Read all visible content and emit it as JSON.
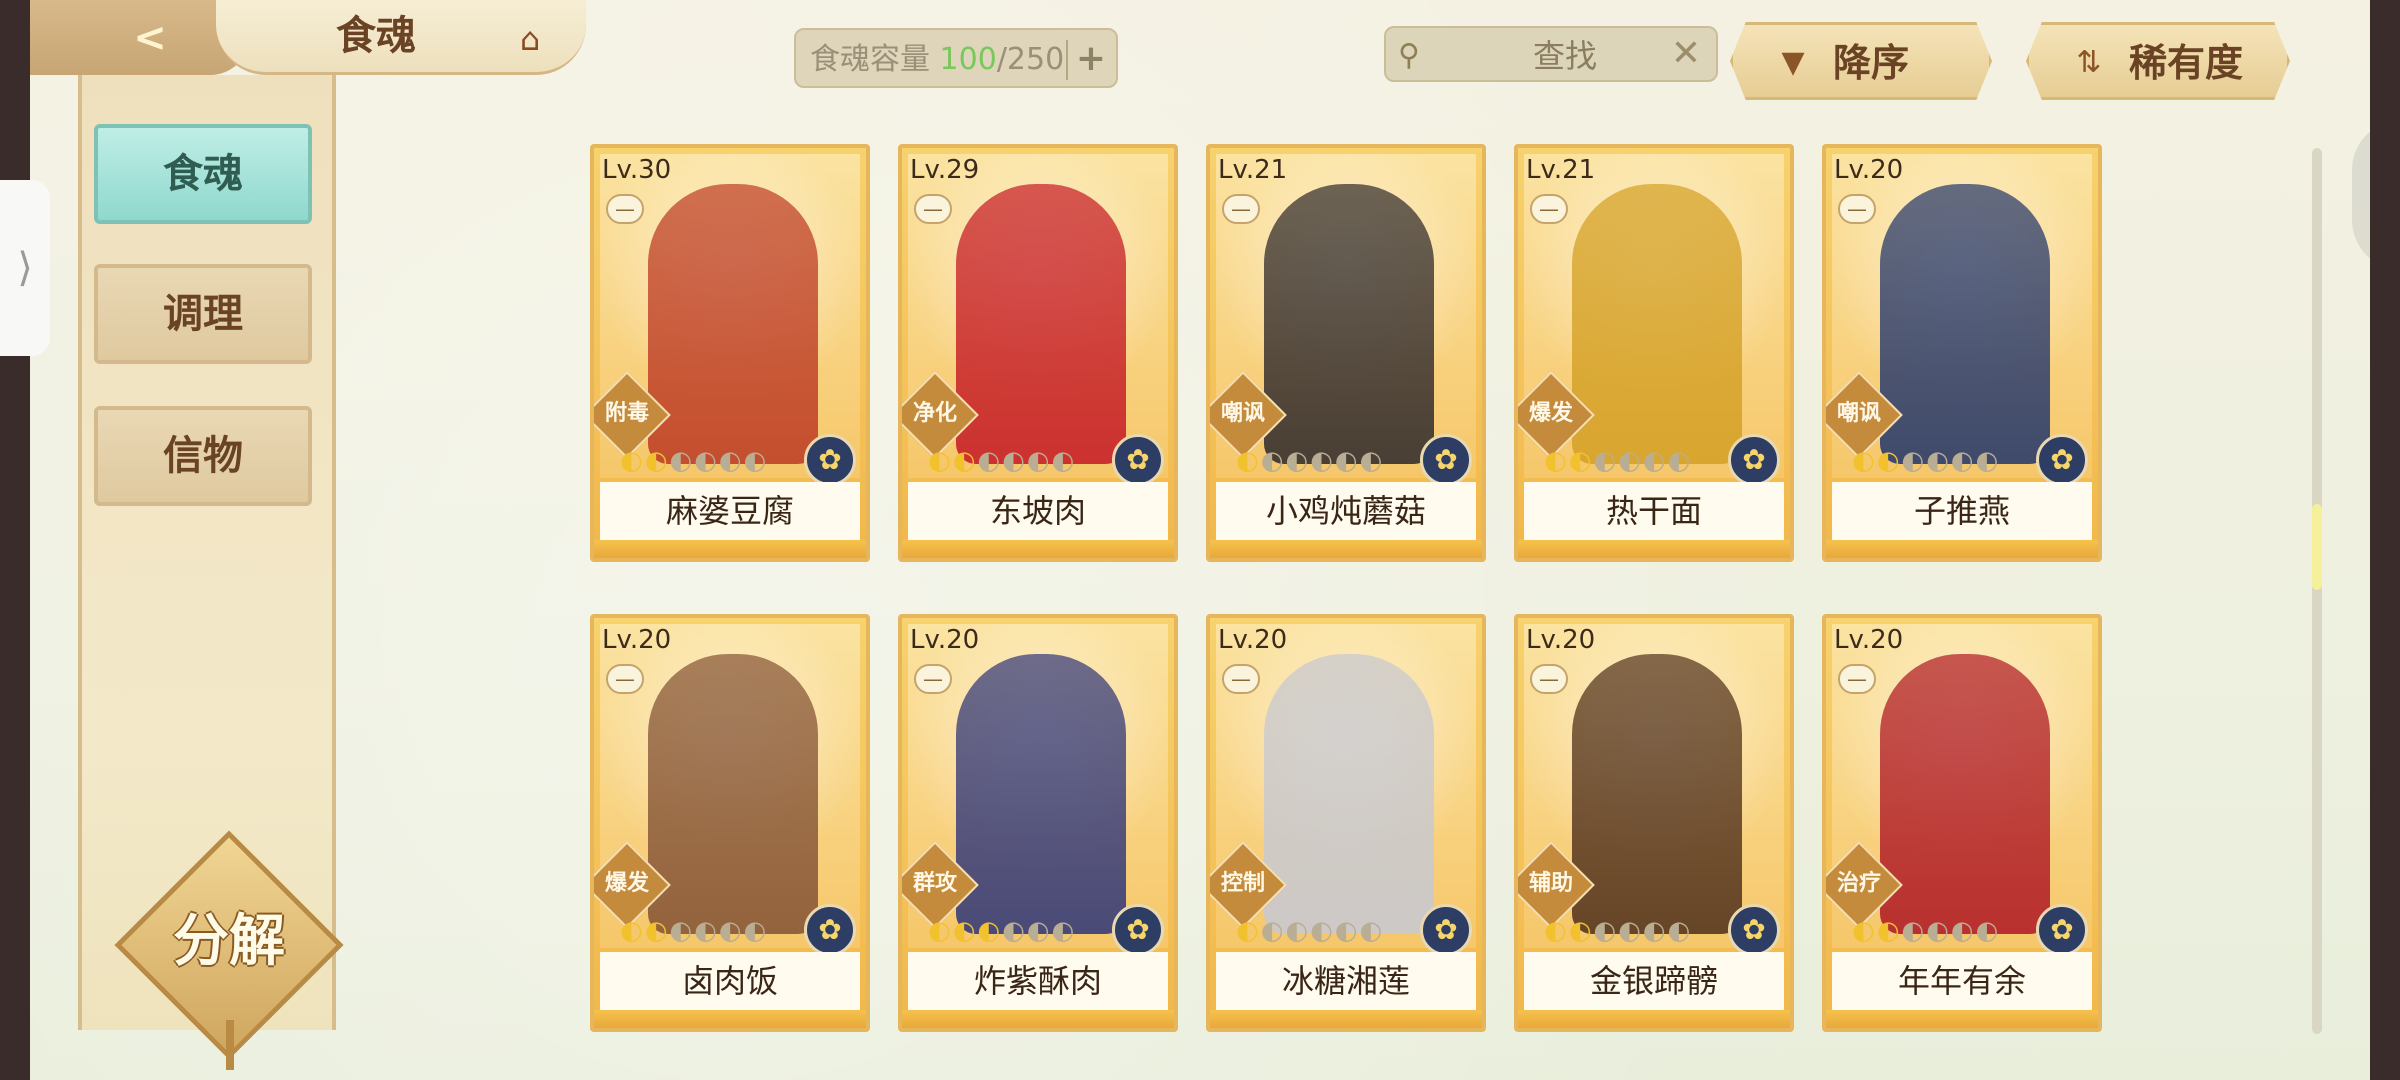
{
  "header": {
    "back_icon": "back-arrow-icon",
    "title": "食魂",
    "home_icon": "pavilion-icon",
    "capacity": {
      "label": "食魂容量 ",
      "current": "100",
      "separator": "/",
      "max": "250",
      "plus": "+"
    },
    "search": {
      "icon": "search-icon",
      "text": "查找",
      "clear": "✕"
    },
    "sort_desc": {
      "icon": "down-triangle-icon",
      "label": "降序"
    },
    "sort_rarity": {
      "icon": "sort-toggle-icon",
      "label": "稀有度"
    }
  },
  "sidebar": {
    "handle": "⟩",
    "items": [
      {
        "label": "食魂",
        "active": true
      },
      {
        "label": "调理",
        "active": false
      },
      {
        "label": "信物",
        "active": false
      }
    ],
    "decompose_label": "分解"
  },
  "cards": [
    {
      "level": "Lv.30",
      "role": "附毒",
      "name": "麻婆豆腐",
      "stars_on": 2,
      "stars_total": 6,
      "color": "#c0442a"
    },
    {
      "level": "Lv.29",
      "role": "净化",
      "name": "东坡肉",
      "stars_on": 2,
      "stars_total": 6,
      "color": "#c8242a"
    },
    {
      "level": "Lv.21",
      "role": "嘲讽",
      "name": "小鸡炖蘑菇",
      "stars_on": 1,
      "stars_total": 6,
      "color": "#3a3330"
    },
    {
      "level": "Lv.21",
      "role": "爆发",
      "name": "热干面",
      "stars_on": 2,
      "stars_total": 6,
      "color": "#d6a32a"
    },
    {
      "level": "Lv.20",
      "role": "嘲讽",
      "name": "子推燕",
      "stars_on": 2,
      "stars_total": 6,
      "color": "#2f3f6c"
    },
    {
      "level": "Lv.20",
      "role": "爆发",
      "name": "卤肉饭",
      "stars_on": 2,
      "stars_total": 6,
      "color": "#8a5a3a"
    },
    {
      "level": "Lv.20",
      "role": "群攻",
      "name": "炸紫酥肉",
      "stars_on": 3,
      "stars_total": 6,
      "color": "#3b3f79"
    },
    {
      "level": "Lv.20",
      "role": "控制",
      "name": "冰糖湘莲",
      "stars_on": 1,
      "stars_total": 6,
      "color": "#c9c9cf"
    },
    {
      "level": "Lv.20",
      "role": "辅助",
      "name": "金银蹄髈",
      "stars_on": 2,
      "stars_total": 6,
      "color": "#5a3a22"
    },
    {
      "level": "Lv.20",
      "role": "治疗",
      "name": "年年有余",
      "stars_on": 2,
      "stars_total": 6,
      "color": "#b3232a"
    }
  ]
}
